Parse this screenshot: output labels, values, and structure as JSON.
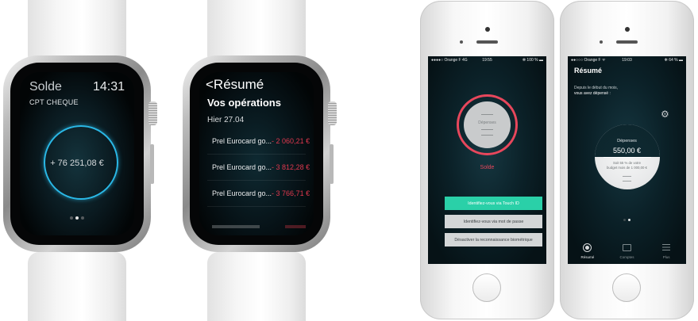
{
  "watch_solde": {
    "title": "Solde",
    "time": "14:31",
    "account": "CPT CHEQUE",
    "balance": "+ 76 251,08 €",
    "page_dots": 3,
    "active_dot": 1
  },
  "watch_resume": {
    "back_title": "<Résumé",
    "heading": "Vos opérations",
    "date": "Hier 27.04",
    "operations": [
      {
        "label": "Prel Eurocard go...",
        "amount": "- 2 060,21 €"
      },
      {
        "label": "Prel Eurocard go...",
        "amount": "- 3 812,28 €"
      },
      {
        "label": "Prel Eurocard go...",
        "amount": "- 3 766,71 €"
      }
    ]
  },
  "phone_login": {
    "status": {
      "carrier": "●●●●○ Orange F  4G",
      "time": "19:55",
      "battery": "✻ 100 % ▬"
    },
    "gauge_label": "Dépenses",
    "solde_label": "Solde",
    "buttons": {
      "touch_id": "Identifiez-vous via Touch ID",
      "password": "Identifiez-vous via mot de passe",
      "disable_bio": "Désactiver la reconnaissance biométrique"
    }
  },
  "phone_resume": {
    "status": {
      "carrier": "●●○○○ Orange F ᯤ",
      "time": "19:03",
      "battery": "✻ 64 % ▬"
    },
    "title": "Résumé",
    "subtitle_1": "Depuis le début du mois,",
    "subtitle_2": "vous avez dépensé :",
    "gauge_label": "Dépenses",
    "amount": "550,00  €",
    "ratio_1": "Soit 55 % de votre",
    "ratio_2": "budget mois de 1 000,00  €",
    "tabs": [
      {
        "label": "Résumé",
        "icon": "resume-icon"
      },
      {
        "label": "Comptes",
        "icon": "accounts-icon"
      },
      {
        "label": "Plus",
        "icon": "more-icon"
      }
    ],
    "colors": {
      "accent_red": "#e8475c",
      "accent_green": "#2ad0a8",
      "accent_blue": "#2ab8e6"
    }
  }
}
